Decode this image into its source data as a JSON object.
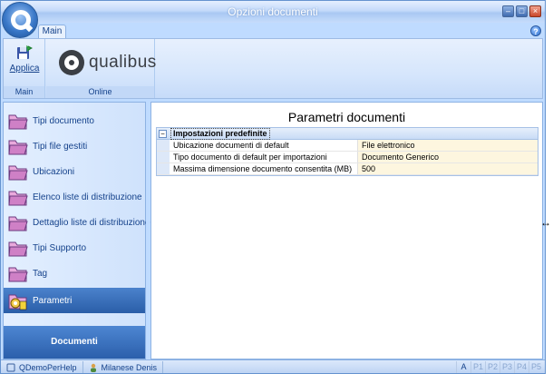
{
  "window": {
    "title": "Opzioni documenti"
  },
  "tabs": [
    {
      "label": "Main"
    }
  ],
  "ribbon": {
    "groups": [
      {
        "label": "Main",
        "buttons": [
          {
            "label": "Applica",
            "icon": "save-apply-icon"
          }
        ]
      },
      {
        "label": "Online",
        "logo_text": "qualibus"
      }
    ]
  },
  "nav": {
    "items": [
      {
        "label": "Tipi documento",
        "icon": "folder-icon"
      },
      {
        "label": "Tipi file gestiti",
        "icon": "folder-icon"
      },
      {
        "label": "Ubicazioni",
        "icon": "folder-icon"
      },
      {
        "label": "Elenco liste di distribuzione",
        "icon": "folder-icon"
      },
      {
        "label": "Dettaglio liste di distribuzione",
        "icon": "folder-icon"
      },
      {
        "label": "Tipi Supporto",
        "icon": "folder-icon"
      },
      {
        "label": "Tag",
        "icon": "folder-icon"
      },
      {
        "label": "Parametri",
        "icon": "gear-folder-icon",
        "active": true
      }
    ],
    "footer": "Documenti"
  },
  "main": {
    "title": "Parametri documenti",
    "group_label": "Impostazioni predefinite",
    "rows": [
      {
        "name": "Ubicazione documenti di default",
        "value": "File elettronico"
      },
      {
        "name": "Tipo documento di default per importazioni",
        "value": "Documento Generico"
      },
      {
        "name": "Massima dimensione documento consentita (MB)",
        "value": "500"
      }
    ]
  },
  "status": {
    "db": "QDemoPerHelp",
    "user": "Milanese Denis",
    "pages": [
      "A",
      "P1",
      "P2",
      "P3",
      "P4",
      "P5"
    ]
  },
  "colors": {
    "accent": "#2a5ea8",
    "ribbon": "#d6e6fc",
    "value_bg": "#fdf6df"
  }
}
